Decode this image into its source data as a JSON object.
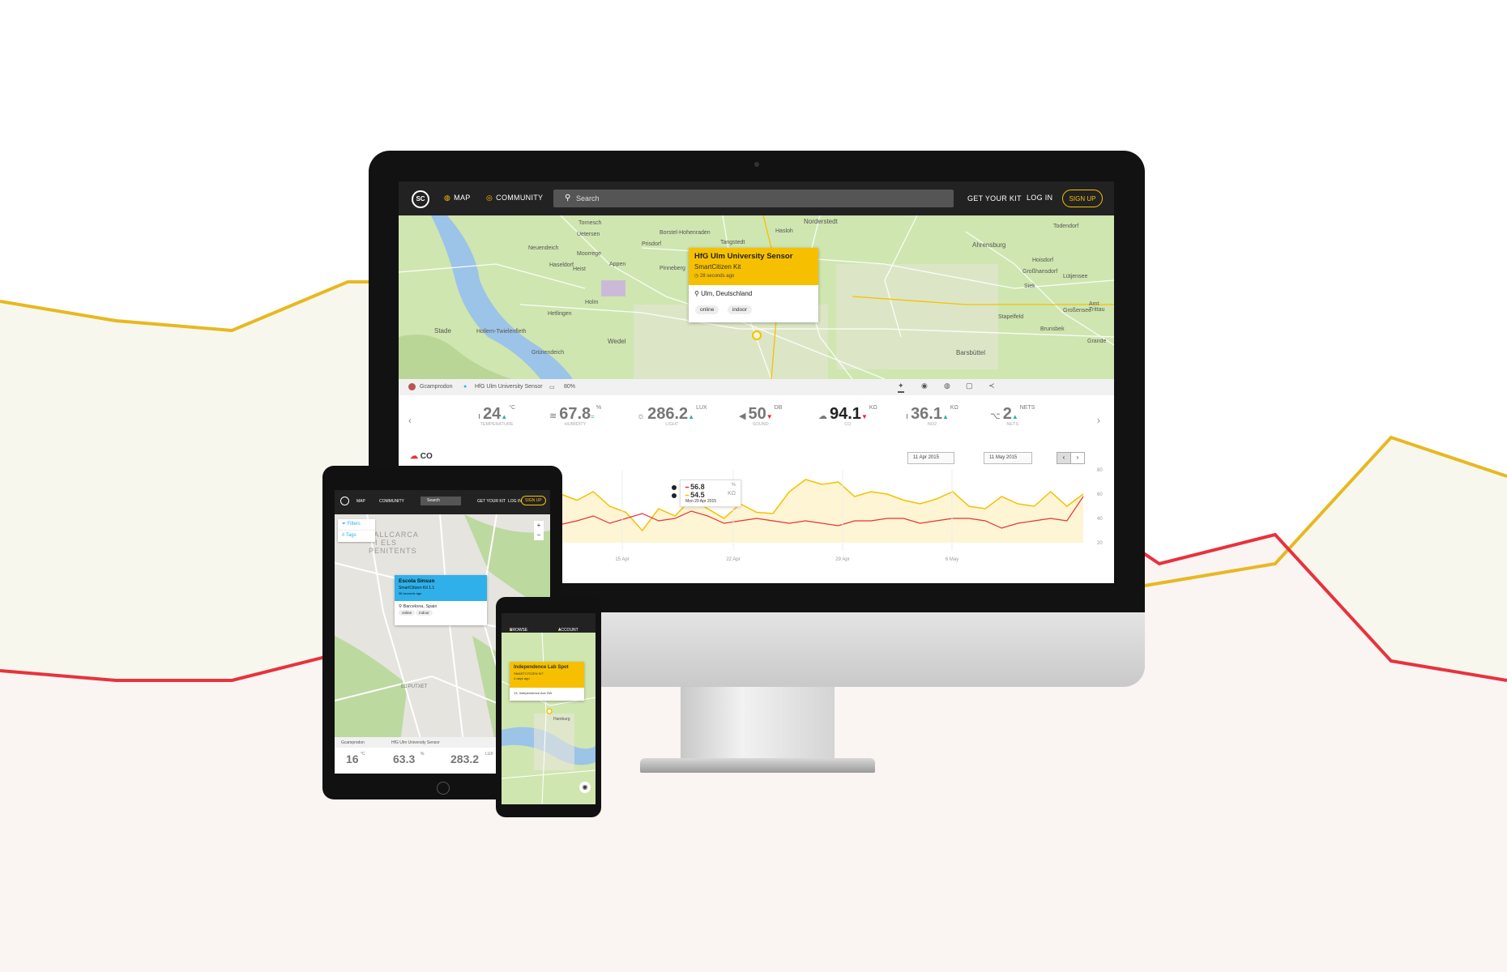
{
  "colors": {
    "accent_yellow": "#f6c000",
    "accent_red": "#e8323c",
    "nav_dark": "#222222",
    "map_green": "#cfe6b0",
    "tablet_popup_blue": "#2fb0ea"
  },
  "desktop": {
    "nav": {
      "logo": "SC",
      "map": "MAP",
      "community": "COMMUNITY",
      "search_placeholder": "Search",
      "get_kit": "GET YOUR KIT",
      "login": "LOG IN",
      "signup": "SIGN UP"
    },
    "map_labels": [
      "Tornesch",
      "Norderstedt",
      "Todendorf",
      "Uetersen",
      "Borstel-Hohenraden",
      "Hasloh",
      "Tangstedt",
      "Ahrensburg",
      "Neuendeich",
      "Moorrege",
      "Prisdorf",
      "Haseldorf",
      "Heist",
      "Appen",
      "Pinneberg",
      "Hoisdorf",
      "Großhansdorf",
      "Lütjensee",
      "Siek",
      "Holm",
      "Hetlingen",
      "Großensee",
      "Stapelfeld",
      "Stade",
      "Hollern-Twielenfleth",
      "Wedel",
      "Grünendeich",
      "Brunsbek",
      "Barsbüttel",
      "Grande",
      "Amt Trittau"
    ],
    "popup": {
      "title": "HfG Ulm University Sensor",
      "kit": "SmartCitizen Kit",
      "time": "28 seconds ago",
      "location": "Ulm, Deutschland",
      "tags": [
        "online",
        "indoor"
      ]
    },
    "kitbar": {
      "user": "Gcamprodon",
      "kit": "HfG Ulm University Sensor",
      "battery": "80%"
    },
    "sensors": [
      {
        "icon": "thermometer-icon",
        "value": "24",
        "unit": "°C",
        "label": "TEMPERATURE",
        "trend": "up"
      },
      {
        "icon": "humidity-icon",
        "value": "67.8",
        "unit": "%",
        "label": "HUMIDITY",
        "trend": "equal"
      },
      {
        "icon": "light-icon",
        "value": "286.2",
        "unit": "LUX",
        "label": "LIGHT",
        "trend": "up"
      },
      {
        "icon": "sound-icon",
        "value": "50",
        "unit": "DB",
        "label": "SOUND",
        "trend": "down"
      },
      {
        "icon": "cloud-icon",
        "value": "94.1",
        "unit": "KΩ",
        "label": "CO",
        "trend": "down"
      },
      {
        "icon": "no2-icon",
        "value": "36.1",
        "unit": "KΩ",
        "label": "NO2",
        "trend": "up"
      },
      {
        "icon": "wifi-icon",
        "value": "2",
        "unit": "NETS",
        "label": "NETS",
        "trend": "up"
      }
    ],
    "chart": {
      "title": "CO",
      "date_from": "11 Apr 2015",
      "date_to": "11 May 2015",
      "tooltip": {
        "val1": "56.8",
        "unit1": "%",
        "val2": "54.5",
        "unit2": "KΩ",
        "date": "Mon 20 Apr 2015"
      },
      "xlabels": [
        "15 Apr",
        "22 Apr",
        "29 Apr",
        "6 May"
      ],
      "ylabels": [
        "80",
        "60",
        "40",
        "20"
      ]
    }
  },
  "tablet": {
    "nav": {
      "map": "MAP",
      "community": "COMMUNITY",
      "search": "Search",
      "get_kit": "GET YOUR KIT",
      "login": "LOG IN",
      "signup": "SIGN UP"
    },
    "filters": "Filters",
    "tags_btn": "Tags",
    "map_labels": [
      "VALLCARCA",
      "I ELS",
      "PENITENTS",
      "EL PUTXET"
    ],
    "popup": {
      "title": "Escola Sinsun",
      "kit": "SmartCitizen Kit 1.1",
      "time": "36 seconds ago",
      "location": "Barcelona, Spain",
      "tags": [
        "online",
        "indoor"
      ]
    },
    "kitbar": {
      "user": "Gcamprodon",
      "kit": "HfG Ulm University Sensor"
    },
    "sensors": [
      {
        "value": "16",
        "unit": "°C"
      },
      {
        "value": "63.3",
        "unit": "%"
      },
      {
        "value": "283.2",
        "unit": "LUX"
      }
    ]
  },
  "phone": {
    "nav": {
      "browse": "BROWSE",
      "account": "ACCOUNT"
    },
    "popup": {
      "title": "Independence Lab Spot",
      "kit": "SMARTCITIZEN KIT",
      "time": "4 days ago",
      "location": "13, Independence Ave SW"
    },
    "map_label": "Hamburg"
  },
  "background_chart": {
    "type": "line",
    "series": [
      {
        "color": "#e8b820",
        "values": [
          0.31,
          0.33,
          0.34,
          0.29,
          0.29,
          0.28,
          0.22,
          0.34,
          0.55,
          0.62,
          0.6,
          0.58,
          0.45,
          0.49
        ]
      },
      {
        "color": "#e8323c",
        "values": [
          0.69,
          0.7,
          0.7,
          0.67,
          0.66,
          0.66,
          0.64,
          0.6,
          0.54,
          0.5,
          0.58,
          0.55,
          0.68,
          0.7
        ]
      }
    ]
  }
}
